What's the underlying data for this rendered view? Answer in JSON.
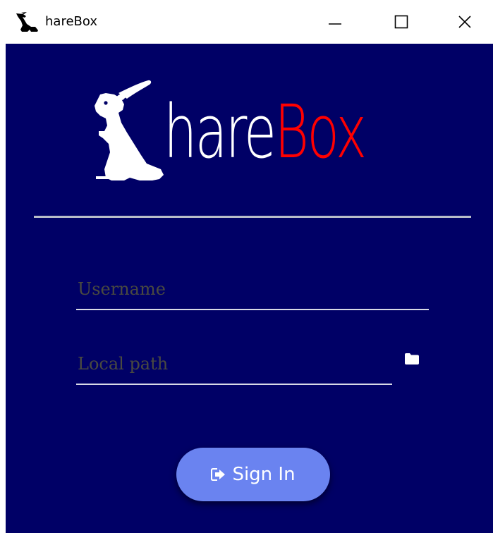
{
  "window": {
    "title": "hareBox",
    "icons": {
      "app": "rabbit-icon",
      "minimize": "minimize-icon",
      "maximize": "maximize-icon",
      "close": "close-icon"
    }
  },
  "logo": {
    "text_primary": "hare",
    "text_accent": "Box",
    "primary_color": "#ffffff",
    "accent_color": "#ff0000"
  },
  "form": {
    "username": {
      "value": "",
      "placeholder": "Username"
    },
    "local_path": {
      "value": "",
      "placeholder": "Local path",
      "browse_icon": "folder-icon"
    }
  },
  "signin": {
    "label": "Sign In",
    "icon": "sign-in-icon"
  },
  "colors": {
    "background": "#000066",
    "divider": "#b8bcc8",
    "button": "#6a83f0",
    "placeholder": "#4a4a40"
  }
}
